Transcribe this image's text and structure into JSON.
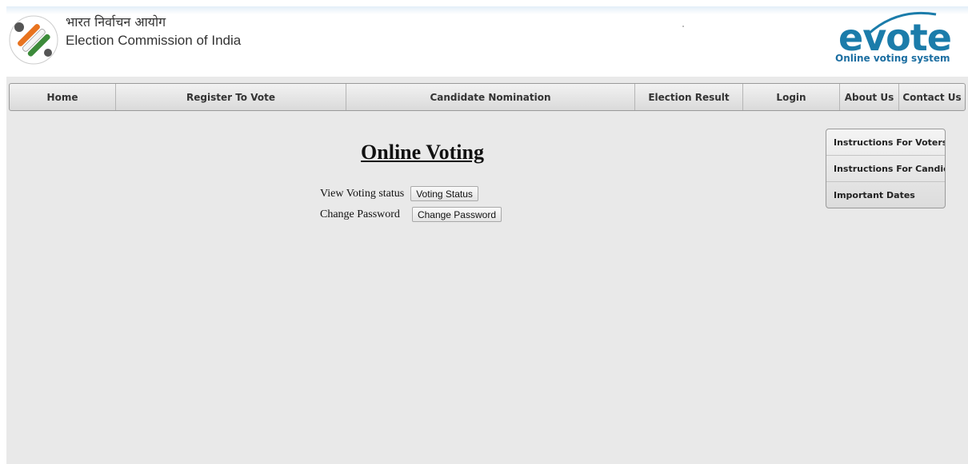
{
  "header": {
    "eci_hindi": "भारत निर्वाचन आयोग",
    "eci_english": "Election Commission of India",
    "evote_word": "evote",
    "evote_tagline": "Online voting system"
  },
  "nav": {
    "items": [
      {
        "label": "Home"
      },
      {
        "label": "Register To Vote"
      },
      {
        "label": "Candidate Nomination"
      },
      {
        "label": "Election Result"
      },
      {
        "label": "Login"
      },
      {
        "label": "About Us"
      },
      {
        "label": "Contact Us"
      }
    ]
  },
  "main": {
    "title": "Online Voting",
    "rows": [
      {
        "label": "View Voting status",
        "button": "Voting Status"
      },
      {
        "label": "Change Password",
        "button": "Change Password"
      }
    ]
  },
  "side_menu": {
    "items": [
      {
        "label": "Instructions For Voters"
      },
      {
        "label": "Instructions For Candidates"
      },
      {
        "label": "Important Dates"
      }
    ]
  },
  "colors": {
    "page_bg": "#e9e9e9",
    "brand_blue": "#1b7caa",
    "nav_bg": "#e6e6e6",
    "logo_orange": "#e8731f",
    "logo_green": "#3c8b3a"
  }
}
